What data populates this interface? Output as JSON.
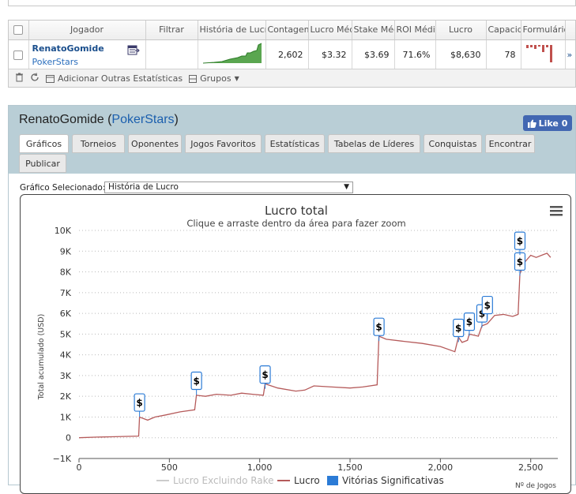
{
  "grid": {
    "headers": [
      "Jogador",
      "Filtrar",
      "História de Lucro",
      "Contagem",
      "Lucro Médio",
      "Stake Média",
      "ROI Médio",
      "Lucro",
      "Capacidade",
      "Formulário",
      ""
    ],
    "row": {
      "player_name": "RenatoGomide",
      "player_site": "PokerStars",
      "contagem": "2,602",
      "lucro_medio": "$3.32",
      "stake_media": "$3.69",
      "roi_medio": "71.6%",
      "lucro": "$8,630",
      "capacidade": "78",
      "extra": "»"
    },
    "footer": {
      "add_stats": "Adicionar Outras Estatísticas",
      "groups": "Grupos"
    }
  },
  "panel": {
    "player": "RenatoGomide",
    "open_paren": " (",
    "site": "PokerStars",
    "close_paren": ")",
    "like_label": "Like 0",
    "tabs": [
      "Gráficos",
      "Torneios",
      "Oponentes",
      "Jogos Favoritos",
      "Estatísticas",
      "Tabelas de Líderes",
      "Conquistas",
      "Encontrar",
      "Publicar"
    ],
    "active_tab": "Gráficos",
    "selector_label": "Gráfico Selecionado:",
    "selector_value": "História de Lucro"
  },
  "chart_data": {
    "type": "line",
    "title": "Lucro total",
    "subtitle": "Clique e arraste dentro da área para fazer zoom",
    "ylabel": "Total acumulado (USD)",
    "xlabel": "Nº de Jogos",
    "xlim": [
      0,
      2650
    ],
    "ylim": [
      -1000,
      10000
    ],
    "x_ticks": [
      0,
      500,
      1000,
      1500,
      2000,
      2500
    ],
    "x_tick_labels": [
      "0",
      "500",
      "1,000",
      "1,500",
      "2,000",
      "2,500"
    ],
    "y_ticks": [
      -1000,
      0,
      1000,
      2000,
      3000,
      4000,
      5000,
      6000,
      7000,
      8000,
      9000,
      10000
    ],
    "y_tick_labels": [
      "−1K",
      "0",
      "1K",
      "2K",
      "3K",
      "4K",
      "5K",
      "6K",
      "7K",
      "8K",
      "9K",
      "10K"
    ],
    "grid": true,
    "legend_position": "bottom",
    "series": [
      {
        "name": "Lucro Excluindo Rake",
        "color": "#cccccc",
        "points": []
      },
      {
        "name": "Lucro",
        "color": "#b55a5a",
        "points": [
          [
            0,
            0
          ],
          [
            100,
            30
          ],
          [
            200,
            50
          ],
          [
            330,
            80
          ],
          [
            335,
            1000
          ],
          [
            380,
            850
          ],
          [
            420,
            1000
          ],
          [
            480,
            1100
          ],
          [
            560,
            1250
          ],
          [
            640,
            1350
          ],
          [
            650,
            2050
          ],
          [
            700,
            2000
          ],
          [
            760,
            2100
          ],
          [
            840,
            2050
          ],
          [
            900,
            2150
          ],
          [
            960,
            2100
          ],
          [
            1020,
            2050
          ],
          [
            1030,
            2600
          ],
          [
            1100,
            2400
          ],
          [
            1200,
            2250
          ],
          [
            1250,
            2300
          ],
          [
            1300,
            2500
          ],
          [
            1400,
            2450
          ],
          [
            1500,
            2400
          ],
          [
            1570,
            2450
          ],
          [
            1650,
            2550
          ],
          [
            1660,
            4900
          ],
          [
            1700,
            4750
          ],
          [
            1800,
            4650
          ],
          [
            1900,
            4550
          ],
          [
            2000,
            4400
          ],
          [
            2080,
            4150
          ],
          [
            2100,
            4850
          ],
          [
            2120,
            4600
          ],
          [
            2150,
            4700
          ],
          [
            2160,
            5000
          ],
          [
            2210,
            4900
          ],
          [
            2230,
            5400
          ],
          [
            2260,
            5500
          ],
          [
            2300,
            5900
          ],
          [
            2350,
            5950
          ],
          [
            2400,
            5850
          ],
          [
            2430,
            5950
          ],
          [
            2440,
            7900
          ],
          [
            2460,
            8400
          ],
          [
            2500,
            8800
          ],
          [
            2530,
            8700
          ],
          [
            2560,
            8800
          ],
          [
            2590,
            8900
          ],
          [
            2610,
            8700
          ]
        ]
      },
      {
        "name": "Vitórias Significativas",
        "color": "#2b7bd6",
        "points": [
          [
            335,
            1700
          ],
          [
            650,
            2750
          ],
          [
            1030,
            3050
          ],
          [
            1660,
            5350
          ],
          [
            2100,
            5300
          ],
          [
            2160,
            5600
          ],
          [
            2230,
            6000
          ],
          [
            2260,
            6400
          ],
          [
            2440,
            8500
          ],
          [
            2440,
            9500
          ]
        ]
      }
    ],
    "win_marker_label": "$"
  }
}
